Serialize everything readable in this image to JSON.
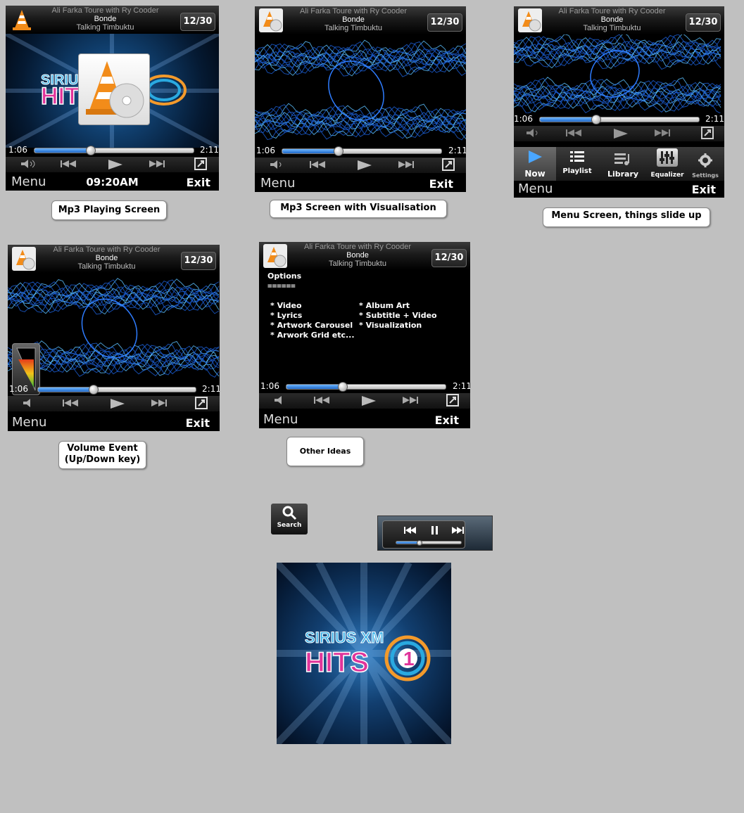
{
  "track": {
    "artist": "Ali Farka Toure with Ry Cooder",
    "title": "Bonde",
    "album": "Talking Timbuktu",
    "counter": "12/30",
    "elapsed": "1:06",
    "duration": "2:11",
    "progress_fraction": 0.35
  },
  "softkeys": {
    "menu": "Menu",
    "exit": "Exit"
  },
  "clock": "09:20AM",
  "captions": {
    "playing": "Mp3 Playing Screen",
    "visualisation": "Mp3 Screen with Visualisation",
    "menu": "Menu Screen, things slide up",
    "volume_line1": "Volume Event",
    "volume_line2": "(Up/Down key)",
    "other": "Other Ideas"
  },
  "menu_items": [
    {
      "label": "Now",
      "icon": "play-icon"
    },
    {
      "label": "Playlist",
      "icon": "list-icon"
    },
    {
      "label": "Library",
      "icon": "library-icon"
    },
    {
      "label": "Equalizer",
      "icon": "equalizer-icon"
    },
    {
      "label": "Settings",
      "icon": "gear-icon"
    }
  ],
  "options": {
    "heading": "Options",
    "underline": "======",
    "left": [
      "* Video",
      "* Lyrics",
      "* Artwork Carousel",
      "* Arwork Grid etc..."
    ],
    "right": [
      "* Album Art",
      "* Subtitle + Video",
      "* Visualization"
    ]
  },
  "search_button": "Search",
  "logo": {
    "line1": "SIRIUS XM",
    "line2": "HITS",
    "number": "1"
  },
  "colors": {
    "accent": "#1f68c9",
    "background": "#c0c0c0",
    "logo_pink": "#e0349a",
    "logo_blue": "#2aa9e0",
    "logo_orange": "#f39a2b"
  }
}
